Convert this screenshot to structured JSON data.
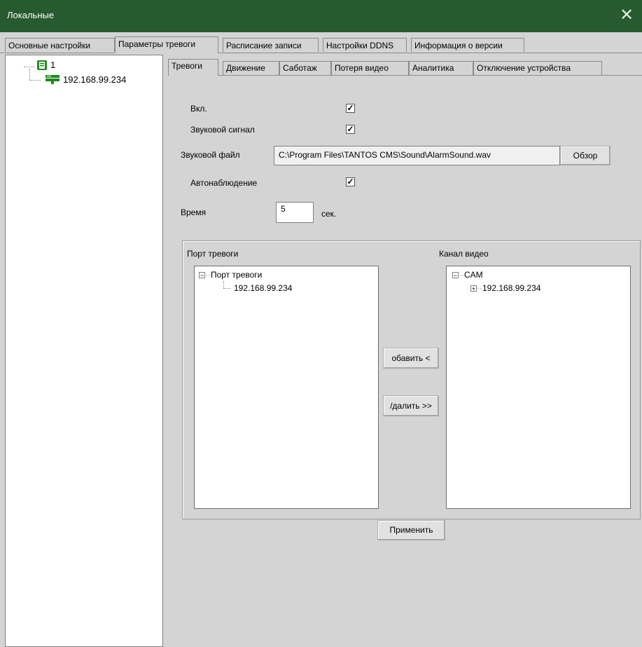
{
  "window": {
    "title": "Локальные",
    "close_glyph": "✕"
  },
  "tabs": [
    {
      "label": "Основные настройки"
    },
    {
      "label": "Параметры тревоги"
    },
    {
      "label": "Расписание записи"
    },
    {
      "label": "Настройки DDNS"
    },
    {
      "label": "Информация о версии"
    }
  ],
  "tree": {
    "root_label": "1",
    "device_label": "192.168.99.234",
    "root_icon": "group-icon",
    "device_icon": "device-icon"
  },
  "subtabs": [
    {
      "label": "Тревоги"
    },
    {
      "label": "Движение"
    },
    {
      "label": "Саботаж"
    },
    {
      "label": "Потеря видео"
    },
    {
      "label": "Аналитика"
    },
    {
      "label": "Отключение устройства"
    }
  ],
  "form": {
    "enable_label": "Вкл.",
    "enable_checked": true,
    "sound_label": "Звуковой сигнал",
    "sound_checked": true,
    "sound_file_label": "Звуковой файл",
    "sound_file_value": "C:\\Program Files\\TANTOS CMS\\Sound\\AlarmSound.wav",
    "browse_label": "Обзор",
    "auto_watch_label": "Автонаблюдение",
    "auto_watch_checked": true,
    "time_label": "Время",
    "time_value": "5",
    "time_unit": "сек."
  },
  "alarm_ports": {
    "title": "Порт тревоги",
    "root": "Порт тревоги",
    "child": "192.168.99.234"
  },
  "video_channels": {
    "title": "Канал видео",
    "root": "CAM",
    "child": "192.168.99.234"
  },
  "transfer": {
    "add_label": "обавить <",
    "remove_label": "/далить >>"
  },
  "apply_label": "Применить",
  "colors": {
    "titlebar": "#275a2f",
    "panel": "#d4d4d4",
    "tree_icon_green": "#1e8a1e"
  }
}
